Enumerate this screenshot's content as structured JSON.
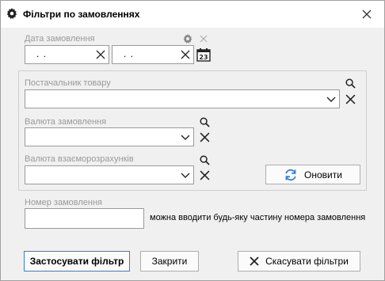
{
  "window": {
    "title": "Фільтри по замовленнях",
    "icon": "gear-icon"
  },
  "order_date": {
    "label": "Дата замовлення",
    "from_value": ". .",
    "to_value": ". ."
  },
  "supplier": {
    "label": "Постачальник товару",
    "value": ""
  },
  "order_currency": {
    "label": "Валюта замовлення",
    "value": ""
  },
  "settlement_currency": {
    "label": "Валюта взаєморозрахунків",
    "value": ""
  },
  "refresh_button": {
    "label": "Оновити"
  },
  "order_number": {
    "label": "Номер замовлення",
    "value": "",
    "hint": "можна вводити будь-яку частину номера замовлення"
  },
  "footer": {
    "apply_label": "Застосувати фільтр",
    "close_label": "Закрити",
    "reset_label": "Скасувати фільтри"
  },
  "colors": {
    "accent": "#2f7fd5",
    "label_gray": "#9a9a9a"
  }
}
